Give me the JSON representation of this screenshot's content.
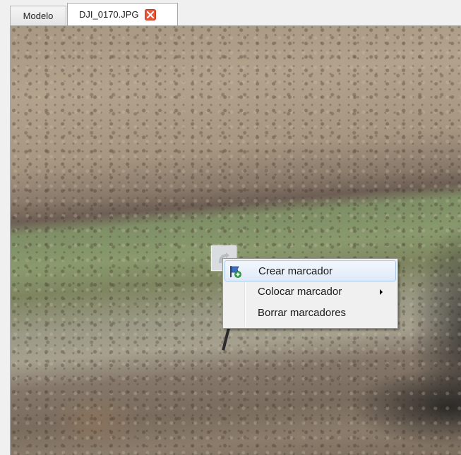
{
  "tabs": [
    {
      "label": "Modelo",
      "active": false
    },
    {
      "label": "DJI_0170.JPG",
      "active": true,
      "close_icon": "close-icon"
    }
  ],
  "context_menu": {
    "items": [
      {
        "label": "Crear marcador",
        "icon": "add-marker-flag-icon",
        "highlighted": true
      },
      {
        "label": "Colocar marcador",
        "submenu": true
      },
      {
        "label": "Borrar marcadores"
      }
    ]
  },
  "colors": {
    "close_button": "#e8573a",
    "menu_highlight_border": "#a8c9ee",
    "menu_background": "#f0f0f0"
  }
}
